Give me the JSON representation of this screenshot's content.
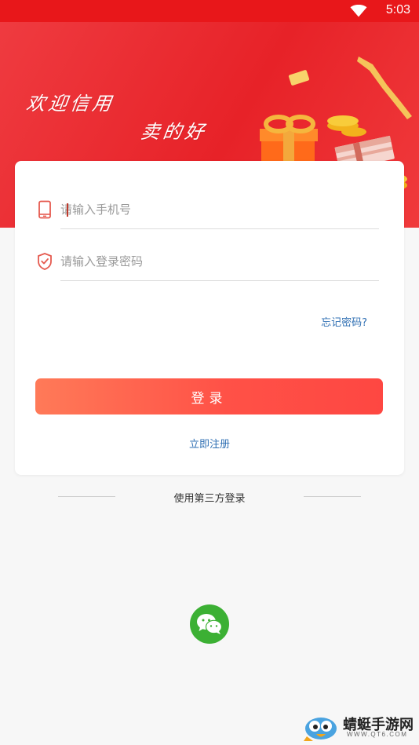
{
  "status_bar": {
    "time": "5:03",
    "wifi_icon": "wifi-icon"
  },
  "banner": {
    "slogan_line1": "欢迎信用",
    "slogan_line2": "卖的好",
    "art": "gift-box-coins-cash-illustration",
    "colors": {
      "primary": "#e8171a",
      "light": "#ef3b40"
    }
  },
  "login_form": {
    "phone_field": {
      "placeholder": "请输入手机号",
      "value": "",
      "icon": "phone-icon"
    },
    "password_field": {
      "placeholder": "请输入登录密码",
      "value": "",
      "icon": "shield-check-icon"
    },
    "forgot_label": "忘记密码?",
    "login_label": "登录",
    "register_label": "立即注册"
  },
  "third_party": {
    "label": "使用第三方登录",
    "wechat_icon": "wechat-icon",
    "wechat_color": "#3cb034"
  },
  "watermark": {
    "name": "蜻蜓手游网",
    "url": "WWW.QT6.COM"
  },
  "colors": {
    "link": "#2f6fb3",
    "button_start": "#ff7a58",
    "button_end": "#fe4742"
  }
}
